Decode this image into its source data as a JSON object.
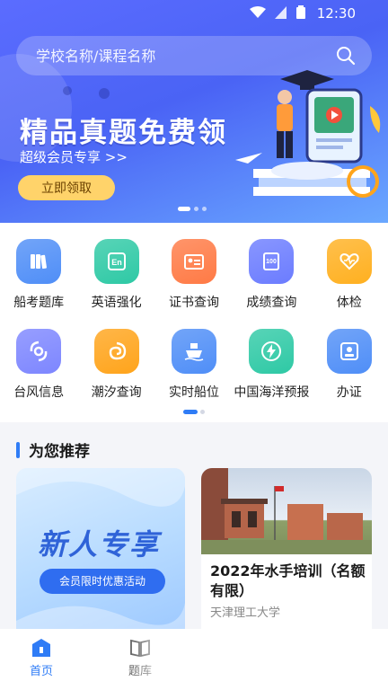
{
  "status_bar": {
    "time": "12:30"
  },
  "search": {
    "placeholder": "学校名称/课程名称"
  },
  "banner": {
    "title": "精品真题免费领",
    "subtitle": "超级会员专享 >>",
    "button_label": "立即领取"
  },
  "grid": {
    "items": [
      {
        "label": "船考题库",
        "icon": "books-icon",
        "color": "#4f8ef7"
      },
      {
        "label": "英语强化",
        "icon": "english-icon",
        "color": "#2ec9a5"
      },
      {
        "label": "证书查询",
        "icon": "certificate-icon",
        "color": "#ff7a45"
      },
      {
        "label": "成绩查询",
        "icon": "score-icon",
        "color": "#6b7cff"
      },
      {
        "label": "体检",
        "icon": "heart-icon",
        "color": "#ffb020"
      },
      {
        "label": "台风信息",
        "icon": "typhoon-icon",
        "color": "#7d86ff"
      },
      {
        "label": "潮汐查询",
        "icon": "tide-icon",
        "color": "#ffa41b"
      },
      {
        "label": "实时船位",
        "icon": "ship-icon",
        "color": "#4f8ef7"
      },
      {
        "label": "中国海洋预报",
        "icon": "lightning-icon",
        "color": "#2ec9a5"
      },
      {
        "label": "办证",
        "icon": "id-card-icon",
        "color": "#4f8ef7"
      }
    ]
  },
  "recommend": {
    "heading": "为您推荐",
    "promo": {
      "title": "新人专享",
      "pill": "会员限时优惠活动"
    },
    "course": {
      "title": "2022年水手培训（名额有限）",
      "school": "天津理工大学"
    }
  },
  "nav": {
    "items": [
      {
        "label": "首页",
        "active": true
      },
      {
        "label": "题库",
        "active": false
      }
    ]
  },
  "colors": {
    "accent": "#2f7cf6",
    "banner": "#4a63f5",
    "button": "#ffd36a"
  }
}
